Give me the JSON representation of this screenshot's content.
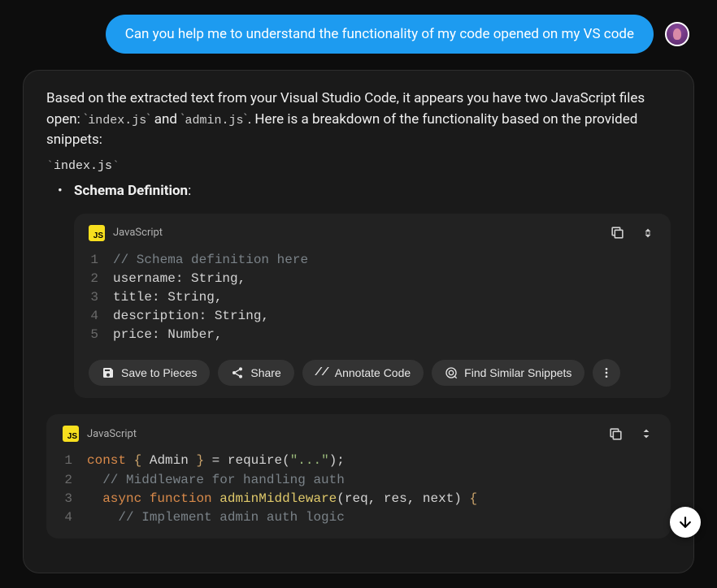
{
  "user_message": "Can you help me to understand the functionality of my code opened on my VS code",
  "response": {
    "intro_prefix": "Based on the extracted text from your Visual Studio Code, it appears you have two JavaScript files open: ",
    "file1": "index.js",
    "intro_mid": " and ",
    "file2": "admin.js",
    "intro_suffix": ". Here is a breakdown of the functionality based on the provided snippets:",
    "heading1": "index.js",
    "bullet1_bold": "Schema Definition",
    "bullet1_suffix": ":"
  },
  "code_blocks": [
    {
      "language": "JavaScript",
      "badge": "JS",
      "lines": [
        {
          "n": "1",
          "tokens": [
            {
              "c": "tok-comment",
              "t": "// Schema definition here"
            }
          ]
        },
        {
          "n": "2",
          "tokens": [
            {
              "c": "tok-prop",
              "t": "username: String,"
            }
          ]
        },
        {
          "n": "3",
          "tokens": [
            {
              "c": "tok-prop",
              "t": "title: String,"
            }
          ]
        },
        {
          "n": "4",
          "tokens": [
            {
              "c": "tok-prop",
              "t": "description: String,"
            }
          ]
        },
        {
          "n": "5",
          "tokens": [
            {
              "c": "tok-prop",
              "t": "price: Number,"
            }
          ]
        }
      ],
      "actions": {
        "save": "Save to Pieces",
        "share": "Share",
        "annotate": "Annotate Code",
        "find": "Find Similar Snippets"
      }
    },
    {
      "language": "JavaScript",
      "badge": "JS",
      "lines": [
        {
          "n": "1",
          "tokens": [
            {
              "c": "tok-keyword",
              "t": "const"
            },
            {
              "c": "",
              "t": " "
            },
            {
              "c": "tok-brace",
              "t": "{"
            },
            {
              "c": "",
              "t": " Admin "
            },
            {
              "c": "tok-brace",
              "t": "}"
            },
            {
              "c": "",
              "t": " = require("
            },
            {
              "c": "tok-string",
              "t": "\"...\""
            },
            {
              "c": "",
              "t": ");"
            }
          ]
        },
        {
          "n": "2",
          "tokens": [
            {
              "c": "",
              "t": "  "
            },
            {
              "c": "tok-comment",
              "t": "// Middleware for handling auth"
            }
          ]
        },
        {
          "n": "3",
          "tokens": [
            {
              "c": "",
              "t": "  "
            },
            {
              "c": "tok-keyword",
              "t": "async"
            },
            {
              "c": "",
              "t": " "
            },
            {
              "c": "tok-keyword",
              "t": "function"
            },
            {
              "c": "",
              "t": " "
            },
            {
              "c": "tok-func",
              "t": "adminMiddleware"
            },
            {
              "c": "",
              "t": "(req, res, next) "
            },
            {
              "c": "tok-brace",
              "t": "{"
            }
          ]
        },
        {
          "n": "4",
          "tokens": [
            {
              "c": "",
              "t": "    "
            },
            {
              "c": "tok-comment",
              "t": "// Implement admin auth logic"
            }
          ]
        }
      ]
    }
  ]
}
